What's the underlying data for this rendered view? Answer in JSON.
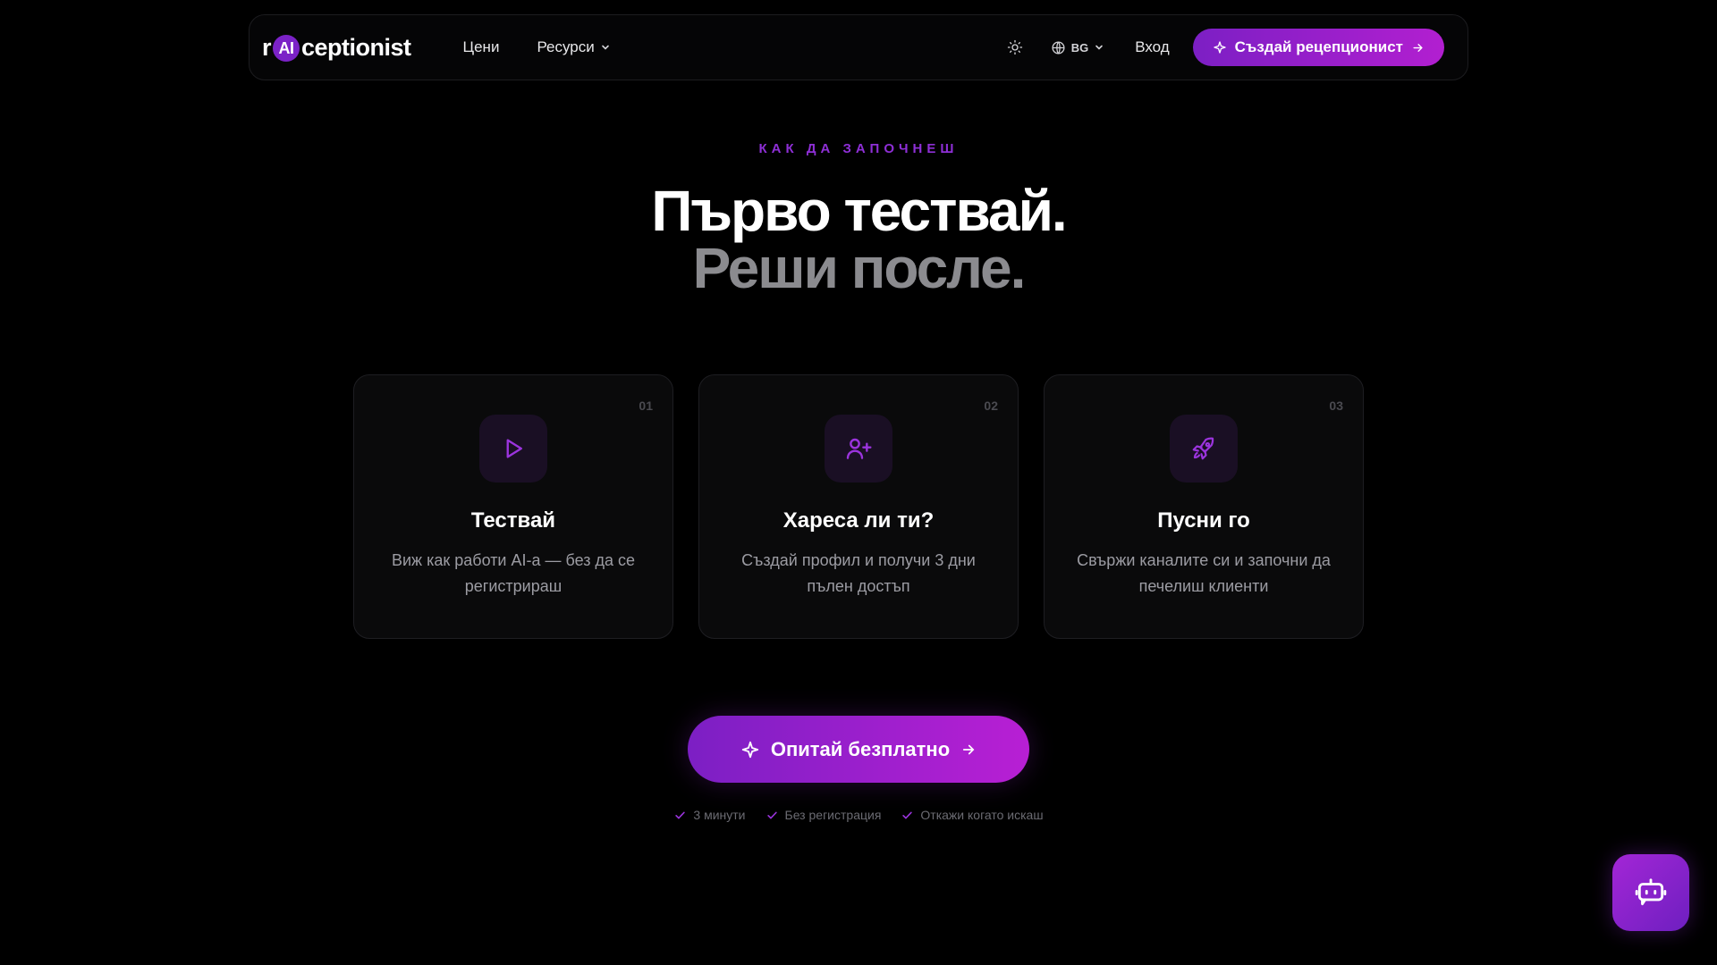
{
  "nav": {
    "logo": {
      "pre": "r",
      "badge": "AI",
      "post": "ceptionist"
    },
    "links": {
      "pricing": "Цени",
      "resources": "Ресурси"
    },
    "lang": "BG",
    "login": "Вход",
    "cta": "Създай рецепционист"
  },
  "hero": {
    "eyebrow": "КАК ДА ЗАПОЧНЕШ",
    "title_line1": "Първо тествай.",
    "title_line2": "Реши после."
  },
  "steps": [
    {
      "num": "01",
      "icon": "play-icon",
      "title": "Тествай",
      "desc": "Виж как работи AI-а — без да се регистрираш"
    },
    {
      "num": "02",
      "icon": "user-plus-icon",
      "title": "Хареса ли ти?",
      "desc": "Създай профил и получи 3 дни пълен достъп"
    },
    {
      "num": "03",
      "icon": "rocket-icon",
      "title": "Пусни го",
      "desc": "Свържи каналите си и започни да печелиш клиенти"
    }
  ],
  "cta": {
    "label": "Опитай безплатно"
  },
  "checks": [
    "3 минути",
    "Без регистрация",
    "Откажи когато искаш"
  ],
  "colors": {
    "accent": "#8e2fd6",
    "gradient_start": "#7c1fc4",
    "gradient_end": "#b81fd4",
    "background": "#000000"
  }
}
